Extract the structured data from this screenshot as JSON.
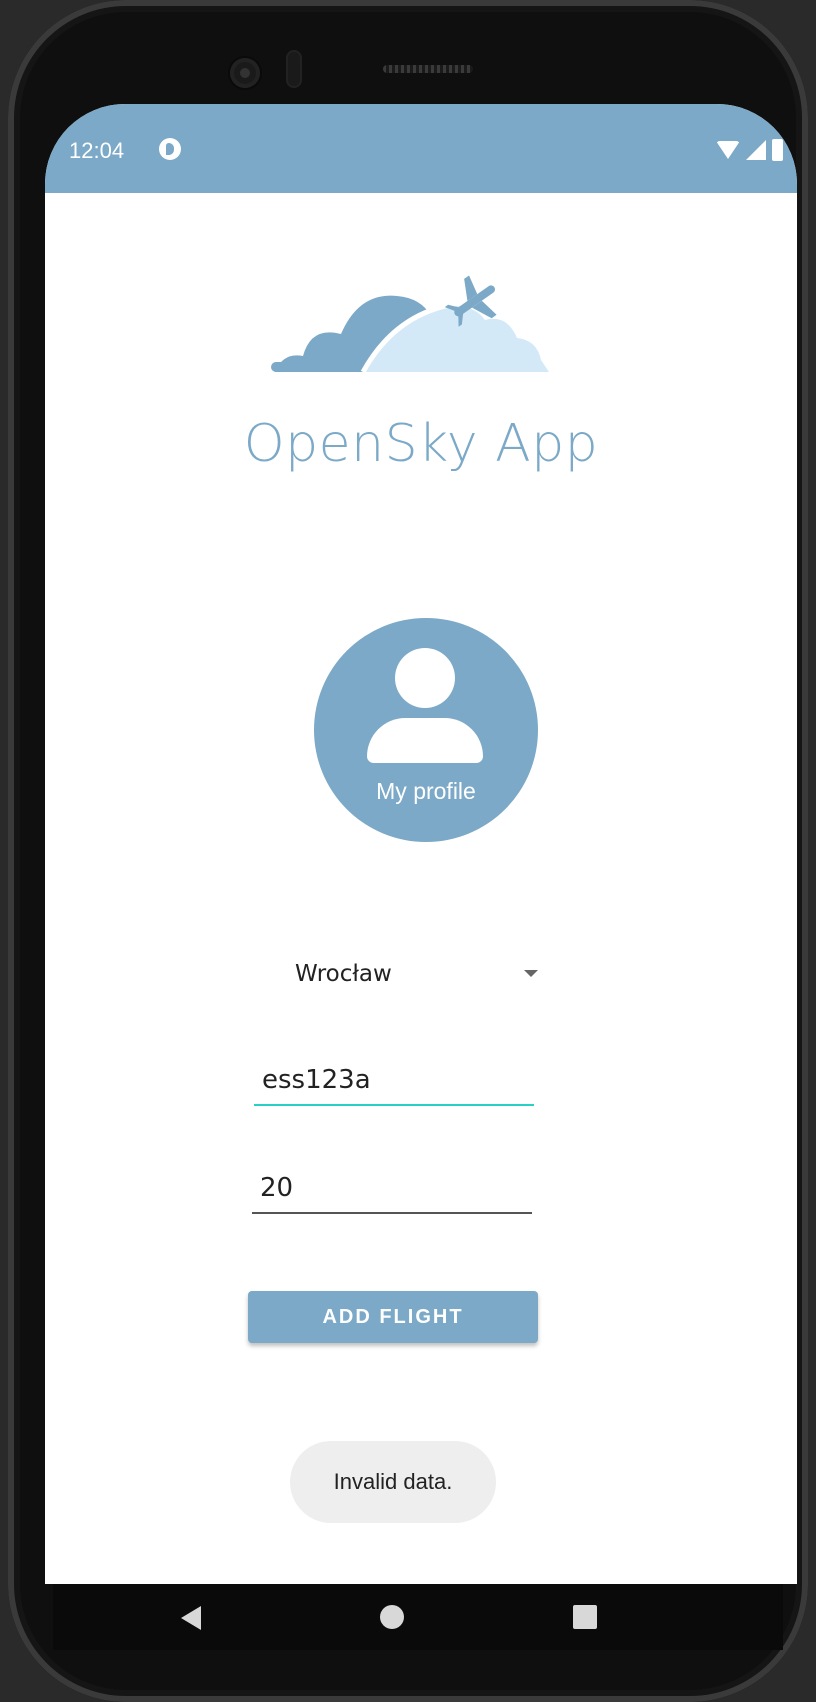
{
  "status_bar": {
    "time": "12:04",
    "app_icon": "app-notification-icon",
    "icons": [
      "wifi-icon",
      "signal-icon",
      "battery-icon"
    ]
  },
  "header": {
    "app_title": "OpenSky App",
    "logo": "airplane-over-clouds-logo"
  },
  "profile": {
    "label": "My profile",
    "icon": "user-icon"
  },
  "form": {
    "city_select": {
      "value": "Wrocław"
    },
    "flight_input": {
      "value": "ess123a"
    },
    "number_input": {
      "value": "20"
    },
    "add_button_label": "ADD FLIGHT"
  },
  "toast": {
    "message": "Invalid data."
  },
  "nav_bar": {
    "icons": [
      "back-icon",
      "home-icon",
      "recents-icon"
    ]
  },
  "colors": {
    "brand": "#7ba9c7",
    "brand_light": "#d4e9f7",
    "accent_underline": "#29d0c5",
    "toast_bg": "#eeeeee"
  }
}
